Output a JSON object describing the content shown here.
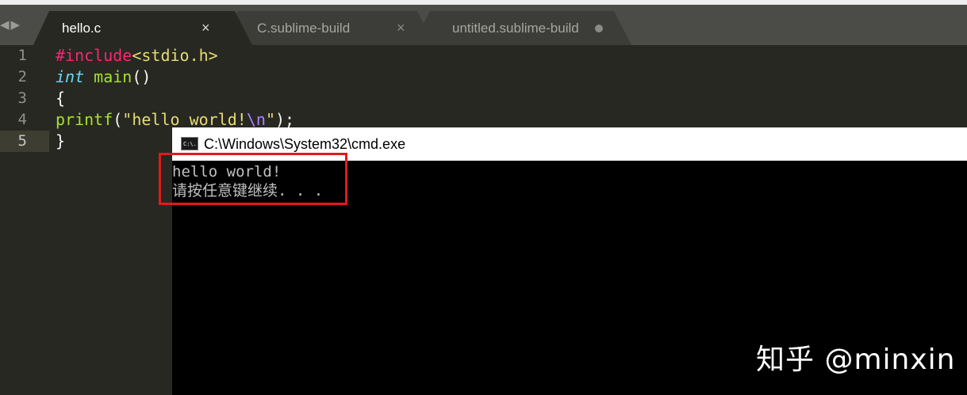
{
  "tabs": [
    {
      "label": "hello.c",
      "state": "active",
      "close_glyph": "×"
    },
    {
      "label": "C.sublime-build",
      "state": "inactive",
      "close_glyph": "×"
    },
    {
      "label": "untitled.sublime-build",
      "state": "inactive-modified"
    }
  ],
  "editor": {
    "line_numbers": [
      "1",
      "2",
      "3",
      "4",
      "5"
    ],
    "current_line": 5,
    "lines": [
      {
        "include_directive": "#include",
        "include_header": "<stdio.h>"
      },
      {
        "type": "int",
        "space": " ",
        "function": "main",
        "parens": "()"
      },
      {
        "text": "{"
      },
      {
        "call": "printf",
        "open": "(",
        "string_start": "\"hello world!",
        "escape": "\\n",
        "string_end": "\"",
        "close": ");"
      },
      {
        "text": "}"
      }
    ]
  },
  "cmd_window": {
    "title": "C:\\Windows\\System32\\cmd.exe",
    "icon_text": "C:\\.",
    "output": [
      "hello world!",
      "请按任意键继续. . ."
    ]
  },
  "watermark": "知乎 @minxin",
  "colors": {
    "editor_bg": "#272822",
    "tabbar_bg": "#4b4c47",
    "active_tab": "#272822",
    "inactive_tab": "#3c3d38",
    "highlight": "#e01b1b",
    "cmd_bg": "#000000"
  }
}
